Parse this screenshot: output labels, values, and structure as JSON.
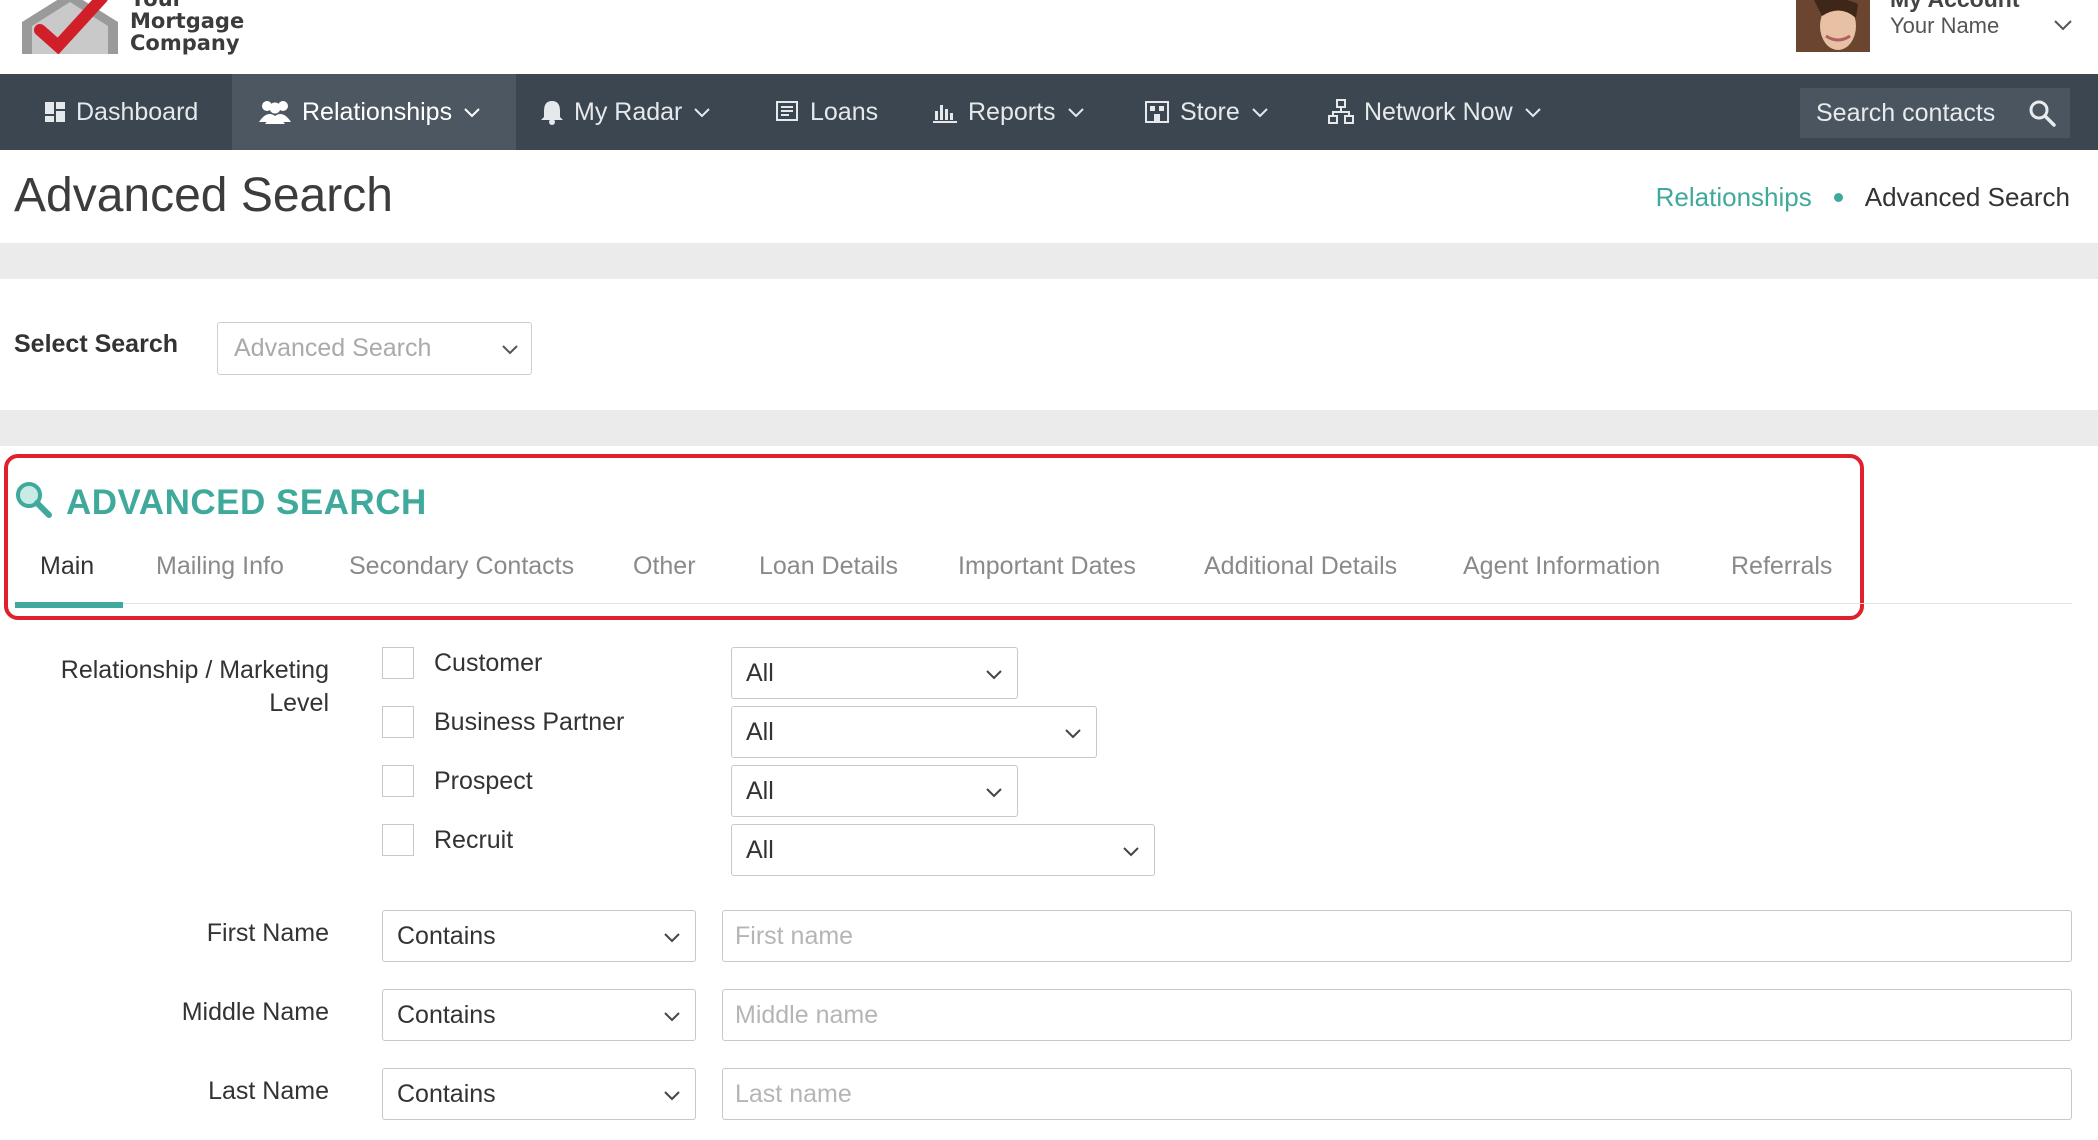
{
  "brand": {
    "line1": "Your",
    "line2": "Mortgage",
    "line3": "Company"
  },
  "account": {
    "title": "My Account",
    "name": "Your Name"
  },
  "nav": {
    "items": [
      {
        "label": "Dashboard",
        "icon": "dashboard-icon"
      },
      {
        "label": "Relationships",
        "icon": "users-icon",
        "active": true
      },
      {
        "label": "My Radar",
        "icon": "bell-icon"
      },
      {
        "label": "Loans",
        "icon": "loans-icon"
      },
      {
        "label": "Reports",
        "icon": "bar-chart-icon"
      },
      {
        "label": "Store",
        "icon": "store-icon"
      },
      {
        "label": "Network Now",
        "icon": "network-icon"
      }
    ],
    "search_placeholder": "Search contacts"
  },
  "page": {
    "title": "Advanced Search"
  },
  "breadcrumb": {
    "parent": "Relationships",
    "current": "Advanced Search"
  },
  "select_search": {
    "label": "Select Search",
    "value": "Advanced Search"
  },
  "panel": {
    "title": "ADVANCED SEARCH",
    "tabs": [
      "Main",
      "Mailing Info",
      "Secondary Contacts",
      "Other",
      "Loan Details",
      "Important Dates",
      "Additional Details",
      "Agent Information",
      "Referrals"
    ],
    "active_tab": "Main"
  },
  "form": {
    "relationship_label_line1": "Relationship / Marketing",
    "relationship_label_line2": "Level",
    "levels": [
      {
        "label": "Customer",
        "value": "All"
      },
      {
        "label": "Business Partner",
        "value": "All"
      },
      {
        "label": "Prospect",
        "value": "All"
      },
      {
        "label": "Recruit",
        "value": "All"
      }
    ],
    "first_name": {
      "label": "First Name",
      "operator": "Contains",
      "placeholder": "First name"
    },
    "middle_name": {
      "label": "Middle Name",
      "operator": "Contains",
      "placeholder": "Middle name"
    },
    "last_name": {
      "label": "Last Name",
      "operator": "Contains",
      "placeholder": "Last name"
    }
  },
  "colors": {
    "accent": "#3fa99b",
    "nav_bg": "#3c4650",
    "highlight": "#e0202a"
  }
}
